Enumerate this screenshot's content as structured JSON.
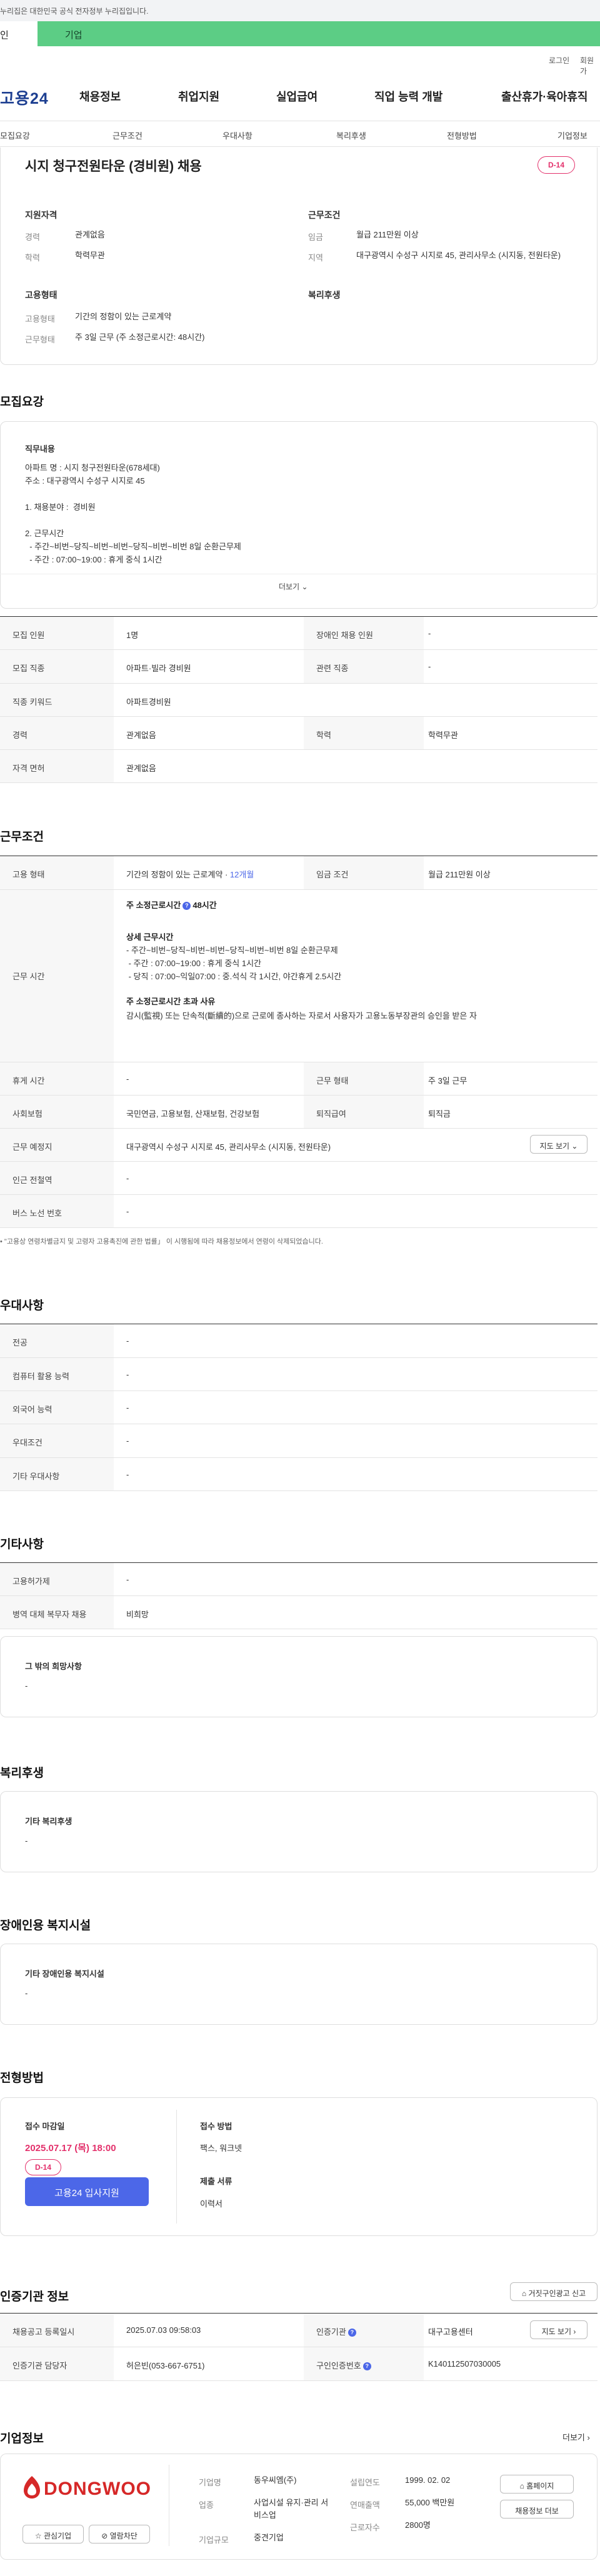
{
  "gov_banner": "누리집은 대한민국 공식 전자정부 누리집입니다.",
  "top_tabs": {
    "individual": "인",
    "corporate": "기업"
  },
  "util": {
    "login": "로그인",
    "signup": "회원가"
  },
  "site": {
    "logo": "고용24"
  },
  "gnb": [
    "채용정보",
    "취업지원",
    "실업급여",
    "직업 능력 개발",
    "출산휴가·육아휴직"
  ],
  "snb": [
    "모집요강",
    "근무조건",
    "우대사항",
    "복리후생",
    "전형방법",
    "기업정보"
  ],
  "summary": {
    "title": "시지 청구전원타운 (경비원) 채용",
    "dday": "D-14",
    "qual_heading": "지원자격",
    "career_label": "경력",
    "career_value": "관계없음",
    "edu_label": "학력",
    "edu_value": "학력무관",
    "cond_heading": "근무조건",
    "wage_label": "임금",
    "wage_value": "월급 211만원 이상",
    "region_label": "지역",
    "region_value": "대구광역시 수성구 시지로 45, 관리사무소 (시지동, 전원타운)",
    "emp_heading": "고용형태",
    "emp_type_label": "고용형태",
    "emp_type_value": "기간의 정함이 있는 근로계약",
    "work_label": "근무형태",
    "work_value": "주 3일 근무 (주 소정근로시간: 48시간)",
    "welfare_heading": "복리후생"
  },
  "recruit": {
    "heading": "모집요강",
    "duty_title": "직무내용",
    "duty_text": "아파트 명 : 시지 청구전원타운(678세대)\n주소 : 대구광역시 수성구 시지로 45\n\n1. 채용분야 :  경비원\n\n2. 근무시간\n  - 주간~비번~당직~비번~비번~당직~비번~비번 8일 순환근무제\n  - 주간 : 07:00~19:00 : 휴게 중식 1시간\n  - 당직 : 07:00~익일07:00 : 중.석식 각 1시간, 야간휴게 2.5시간",
    "more": "더보기",
    "rows": {
      "headcount_label": "모집 인원",
      "headcount_value": "1명",
      "disabled_label": "장애인 채용 인원",
      "disabled_value": "-",
      "job_label": "모집 직종",
      "job_value": "아파트·빌라 경비원",
      "related_label": "관련 직종",
      "related_value": "-",
      "keyword_label": "직종 키워드",
      "keyword_value": "아파트경비원",
      "career_label": "경력",
      "career_value": "관계없음",
      "edu_label": "학력",
      "edu_value": "학력무관",
      "license_label": "자격 면허",
      "license_value": "관계없음"
    }
  },
  "conditions": {
    "heading": "근무조건",
    "emp_label": "고용 형태",
    "emp_value": "기간의 정함이 있는 근로계약 · ",
    "emp_period": "12개월",
    "wage_label": "임금 조건",
    "wage_value": "월급 211만원 이상",
    "hours_label": "근무 시간",
    "hours_weekly": "주 소정근로시간",
    "hours_weekly_value": "48시간",
    "hours_detail_title": "상세 근무시간",
    "hours_detail": "- 주간~비번~당직~비번~비번~당직~비번~비번 8일 순환근무제\n - 주간 : 07:00~19:00 : 휴게 중식 1시간\n - 당직 : 07:00~익일07:00 : 중.석식 각 1시간, 야간휴게 2.5시간",
    "exceed_title": "주 소정근로시간 초과 사유",
    "exceed_text": "감시(監視) 또는 단속적(斷續的)으로 근로에 종사하는 자로서 사용자가 고용노동부장관의 승인을 받은 자",
    "break_label": "휴게 시간",
    "break_value": "-",
    "worktype_label": "근무 형태",
    "worktype_value": "주 3일 근무",
    "insurance_label": "사회보험",
    "insurance_value": "국민연금, 고용보험, 산재보험, 건강보험",
    "severance_label": "퇴직급여",
    "severance_value": "퇴직금",
    "location_label": "근무 예정지",
    "location_value": "대구광역시 수성구 시지로 45, 관리사무소 (시지동, 전원타운)",
    "map_button": "지도 보기",
    "station_label": "인근 전철역",
    "station_value": "-",
    "bus_label": "버스 노선 번호",
    "bus_value": "-",
    "notice": "\"고용상 연령차별금지 및 고령자 고용촉진에 관한 법률」 이 시행됨에 따라 채용정보에서 연령이 삭제되었습니다."
  },
  "preference": {
    "heading": "우대사항",
    "rows": [
      {
        "label": "전공",
        "value": "-"
      },
      {
        "label": "컴퓨터 활용 능력",
        "value": "-"
      },
      {
        "label": "외국어 능력",
        "value": "-"
      },
      {
        "label": "우대조건",
        "value": "-"
      },
      {
        "label": "기타 우대사항",
        "value": "-"
      }
    ]
  },
  "etc": {
    "heading": "기타사항",
    "rows": [
      {
        "label": "고용허가제",
        "value": "-"
      },
      {
        "label": "병역 대체 복무자 채용",
        "value": "비희망"
      }
    ],
    "other_title": "그 밖의 희망사항",
    "other_value": "-"
  },
  "welfare": {
    "heading": "복리후생",
    "title": "기타 복리후생",
    "value": "-"
  },
  "facility": {
    "heading": "장애인용 복지시설",
    "title": "기타 장애인용 복지시설",
    "value": "-"
  },
  "process": {
    "heading": "전형방법",
    "deadline_label": "접수 마감일",
    "deadline_value": "2025.07.17 (목) 18:00",
    "dday": "D-14",
    "apply_button": "고용24 입사지원",
    "method_label": "접수 방법",
    "method_value": "팩스, 워크넷",
    "docs_label": "제출 서류",
    "docs_value": "이력서"
  },
  "agency": {
    "heading": "인증기관 정보",
    "report_button": "거짓구인광고 신고",
    "reg_label": "채용공고 등록일시",
    "reg_value": "2025.07.03 09:58:03",
    "agency_label": "인증기관",
    "agency_value": "대구고용센터",
    "map_button": "지도 보기",
    "manager_label": "인증기관 담당자",
    "manager_value": "허은빈(053-667-6751)",
    "id_label": "구인인증번호",
    "id_value": "K140112507030005"
  },
  "company": {
    "heading": "기업정보",
    "more": "더보기",
    "logo_text": "DONGWOO",
    "interest_button": "관심기업",
    "block_button": "열람차단",
    "name_label": "기업명",
    "name_value": "동우씨엠(주)",
    "industry_label": "업종",
    "industry_value": "사업시설 유지·관리 서비스업",
    "size_label": "기업규모",
    "size_value": "중견기업",
    "founded_label": "설립연도",
    "founded_value": "1999. 02. 02",
    "sales_label": "연매출액",
    "sales_value": "55,000 백만원",
    "staff_label": "근로자수",
    "staff_value": "2800명",
    "homepage_button": "홈페이지",
    "jobs_button": "채용정보 더보"
  }
}
